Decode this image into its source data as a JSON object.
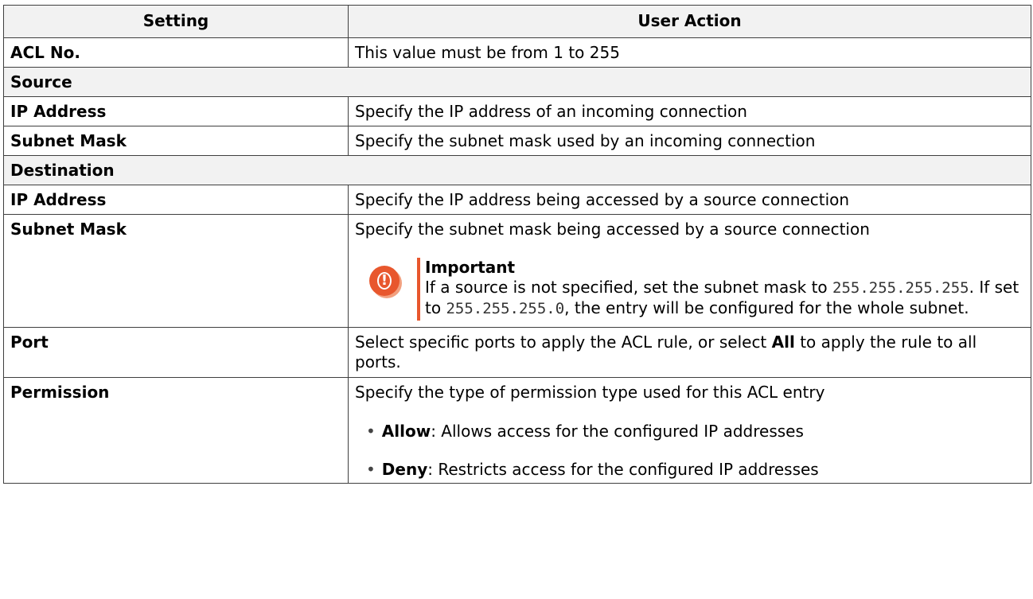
{
  "header": {
    "setting": "Setting",
    "user_action": "User Action"
  },
  "rows": [
    {
      "setting": "ACL No.",
      "action": "This value must be from 1 to 255"
    },
    {
      "section": "Source"
    },
    {
      "setting": "IP Address",
      "action": "Specify the IP address of an incoming connection"
    },
    {
      "setting": "Subnet Mask",
      "action": "Specify the subnet mask used by an incoming connection"
    },
    {
      "section": "Destination"
    },
    {
      "setting": "IP Address",
      "action": "Specify the IP address being accessed by a source connection"
    },
    {
      "setting": "Subnet Mask",
      "action": "Specify the subnet mask being accessed by a source connection"
    },
    {
      "setting": "Port",
      "action_pre": "Select specific ports to apply the ACL rule, or select ",
      "action_bold": "All",
      "action_post": " to apply the rule to all ports."
    },
    {
      "setting": "Permission",
      "action": "Specify the type of permission type used for this ACL entry"
    }
  ],
  "note": {
    "title": "Important",
    "text1": "If a source is not specified, set the subnet mask to ",
    "code1": "255.255.255.255",
    "text2": ". If set to ",
    "code2": "255.255.255.0",
    "text3": ", the entry will be configured for the whole subnet.",
    "icon": "exclamation-icon",
    "color": "#e8572d"
  },
  "permission_options": [
    {
      "name": "Allow",
      "desc": ": Allows access for the configured IP addresses"
    },
    {
      "name": "Deny",
      "desc": ": Restricts access for the configured IP addresses"
    }
  ]
}
